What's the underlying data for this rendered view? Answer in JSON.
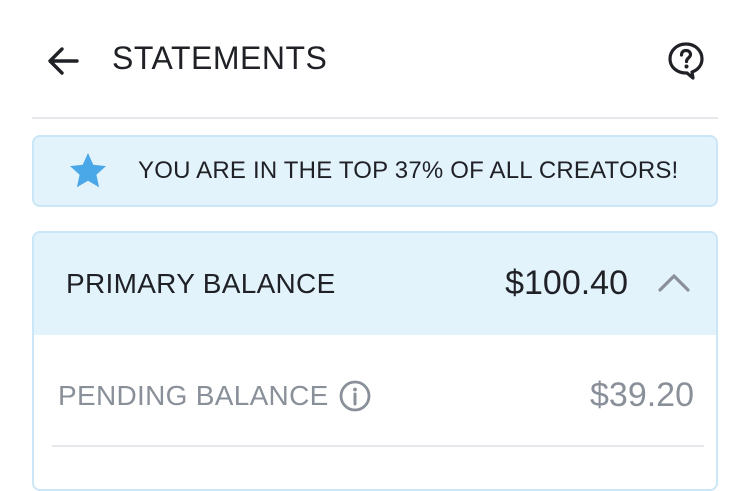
{
  "header": {
    "title": "STATEMENTS",
    "back_icon": "arrow-left-icon",
    "help_icon": "help-icon"
  },
  "rank_banner": {
    "icon": "star-icon",
    "text": "YOU ARE IN THE TOP 37% OF ALL CREATORS!"
  },
  "balances": {
    "primary_label": "PRIMARY BALANCE",
    "primary_amount": "$100.40",
    "collapse_icon": "chevron-up-icon",
    "pending_label": "PENDING BALANCE",
    "pending_info_icon": "info-icon",
    "pending_amount": "$39.20"
  },
  "colors": {
    "accent_blue": "#4aa8e8",
    "banner_bg": "#e3f3fc",
    "muted_text": "#8a9099"
  }
}
